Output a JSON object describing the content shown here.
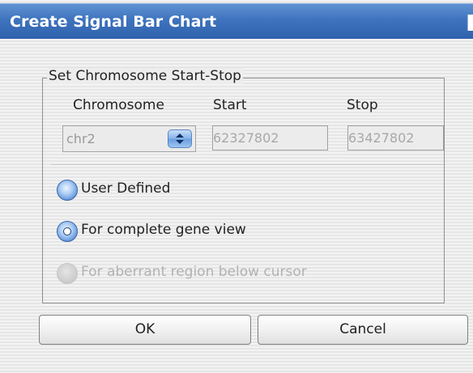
{
  "window": {
    "title": "Create Signal Bar Chart"
  },
  "group": {
    "legend": "Set Chromosome Start-Stop",
    "columns": {
      "chromosome": "Chromosome",
      "start": "Start",
      "stop": "Stop"
    },
    "chromosome_select": {
      "value": "chr2"
    },
    "start_field": {
      "value": "62327802"
    },
    "stop_field": {
      "value": "63427802"
    }
  },
  "options": [
    {
      "label": "User Defined",
      "selected": false,
      "enabled": true
    },
    {
      "label": "For complete gene view",
      "selected": true,
      "enabled": true
    },
    {
      "label": "For aberrant region below cursor",
      "selected": false,
      "enabled": false
    }
  ],
  "buttons": {
    "ok": "OK",
    "cancel": "Cancel"
  },
  "colors": {
    "title_bar": "#3e73bd",
    "radio_blue": "#4f86d6",
    "disabled_text": "#b2b2b2"
  },
  "icons": {
    "select_spinner": "up-down-arrows-icon"
  }
}
